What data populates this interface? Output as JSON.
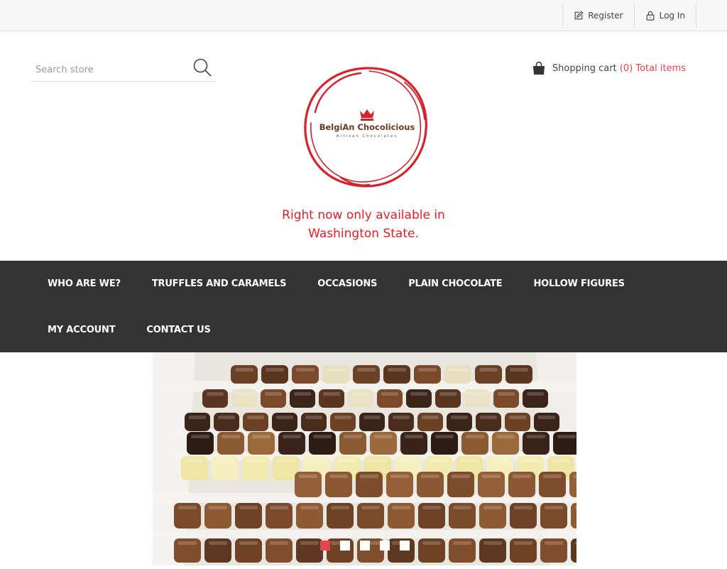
{
  "header": {
    "register_label": "Register",
    "login_label": "Log In"
  },
  "search": {
    "placeholder": "Search store"
  },
  "cart": {
    "label": "Shopping cart",
    "count": "(0)",
    "total": "Total items"
  },
  "logo": {
    "brand": "BelgiAn Chocolicious",
    "sub": "Artisan Chocolates"
  },
  "tagline": {
    "line1": "Right now only available in",
    "line2": "Washington State."
  },
  "nav": {
    "row1": [
      "WHO ARE WE?",
      "TRUFFLES AND CARAMELS",
      "OCCASIONS",
      "PLAIN CHOCOLATE",
      "HOLLOW FIGURES"
    ],
    "row2": [
      "MY ACCOUNT",
      "CONTACT US"
    ]
  },
  "slider": {
    "active_index": 0,
    "slide_count": 5
  },
  "colors": {
    "accent": "#e4444c",
    "brand_red": "#e61d24",
    "nav_bg": "#333333"
  }
}
